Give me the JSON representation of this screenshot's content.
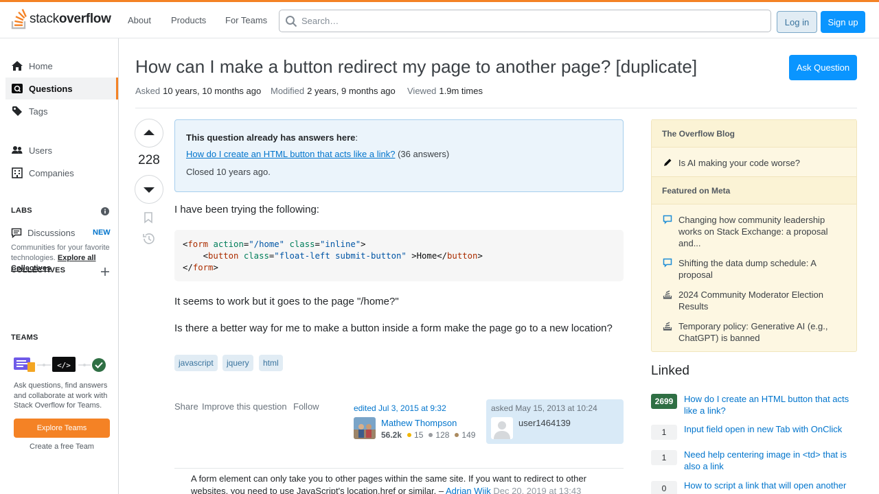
{
  "header": {
    "logo_light": "stack",
    "logo_bold": "overflow",
    "nav": [
      "About",
      "Products",
      "For Teams"
    ],
    "search_placeholder": "Search…",
    "login": "Log in",
    "signup": "Sign up"
  },
  "sidebar": {
    "items": [
      {
        "label": "Home",
        "icon": "home-icon"
      },
      {
        "label": "Questions",
        "icon": "questions-icon"
      },
      {
        "label": "Tags",
        "icon": "tag-icon"
      },
      {
        "label": "Users",
        "icon": "users-icon"
      },
      {
        "label": "Companies",
        "icon": "building-icon"
      }
    ],
    "labs_heading": "LABS",
    "discussions": "Discussions",
    "new_badge": "NEW",
    "collectives_heading": "COLLECTIVES",
    "collectives_desc": "Communities for your favorite technologies.",
    "collectives_link": "Explore all Collectives",
    "teams_heading": "TEAMS",
    "teams_desc": "Ask questions, find answers and collaborate at work with Stack Overflow for Teams.",
    "explore_teams": "Explore Teams",
    "create_team": "Create a free Team"
  },
  "question": {
    "title": "How can I make a button redirect my page to another page? [duplicate]",
    "ask_button": "Ask Question",
    "asked_label": "Asked",
    "asked_value": "10 years, 10 months ago",
    "modified_label": "Modified",
    "modified_value": "2 years, 9 months ago",
    "viewed_label": "Viewed",
    "viewed_value": "1.9m times",
    "votes": "228",
    "duplicate": {
      "heading": "This question already has answers here",
      "link": "How do I create an HTML button that acts like a link?",
      "answers": "(36 answers)",
      "closed": "Closed 10 years ago."
    },
    "body_intro": "I have been trying the following:",
    "code": {
      "line1": {
        "open": "<",
        "tag": "form",
        "attr1": "action",
        "val1": "\"/home\"",
        "attr2": "class",
        "val2": "\"inline\"",
        "close": ">"
      },
      "line2": {
        "open": "<",
        "tag": "button",
        "attr1": "class",
        "val1": "\"float-left submit-button\"",
        "text": " >Home</",
        "endtag": "button",
        "close": ">"
      },
      "line3": {
        "open": "</",
        "tag": "form",
        "close": ">"
      }
    },
    "body_p2": "It seems to work but it goes to the page \"/home?\"",
    "body_p3": "Is there a better way for me to make a button inside a form make the page go to a new location?",
    "tags": [
      "javascript",
      "jquery",
      "html"
    ],
    "menu": [
      "Share",
      "Improve this question",
      "Follow"
    ],
    "edited": "edited Jul 3, 2015 at 9:32",
    "editor": {
      "name": "Mathew Thompson",
      "rep": "56.2k",
      "gold": "15",
      "silver": "128",
      "bronze": "149"
    },
    "asked_card": {
      "label": "asked May 15, 2013 at 10:24",
      "name": "user1464139"
    },
    "comment": {
      "text": "A form element can only take you to other pages within the same site. If you want to redirect to other websites, you need to use JavaScript's location.href or similar. –",
      "author": "Adrian Wiik",
      "date": "Dec 20, 2019 at 13:43"
    }
  },
  "right": {
    "blog_heading": "The Overflow Blog",
    "blog_items": [
      "Is AI making your code worse?"
    ],
    "meta_heading": "Featured on Meta",
    "meta_items": [
      "Changing how community leadership works on Stack Exchange: a proposal and...",
      "Shifting the data dump schedule: A proposal",
      "2024 Community Moderator Election Results",
      "Temporary policy: Generative AI (e.g., ChatGPT) is banned"
    ],
    "linked_heading": "Linked",
    "linked": [
      {
        "score": "2699",
        "text": "How do I create an HTML button that acts like a link?"
      },
      {
        "score": "1",
        "text": "Input field open in new Tab with OnClick"
      },
      {
        "score": "1",
        "text": "Need help centering image in <td> that is also a link"
      },
      {
        "score": "0",
        "text": "How to script a link that will open another"
      }
    ]
  },
  "colors": {
    "accent": "#f48225",
    "link": "#0074cc",
    "primary_button": "#0a95ff",
    "accepted_score": "#2f6f44"
  }
}
